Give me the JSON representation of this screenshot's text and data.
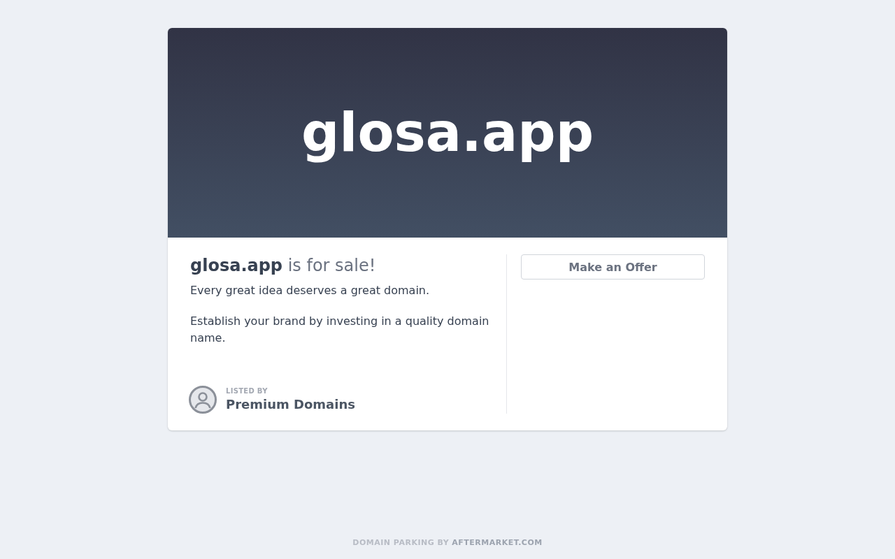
{
  "hero": {
    "domain": "glosa.app"
  },
  "details": {
    "heading": "**glosa.app** is for sale!",
    "paragraphs": [
      "Every great idea deserves a great domain.",
      "Establish your brand by investing in a quality domain name."
    ],
    "listed_by": {
      "label": "LISTED BY",
      "seller": "Premium Domains"
    }
  },
  "actions": {
    "buttons": [
      "Make an Offer"
    ]
  },
  "footer": {
    "text": "DOMAIN PARKING BY",
    "link": "AFTERMARKET.COM"
  }
}
